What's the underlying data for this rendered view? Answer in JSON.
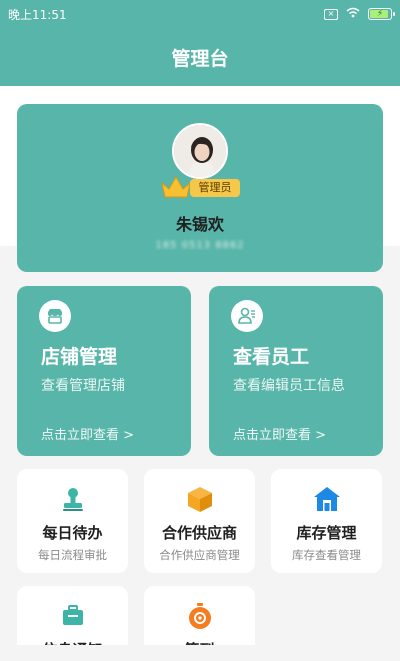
{
  "status_bar": {
    "time": "晚上11:51",
    "sim_icon": "sim-x-icon",
    "wifi_icon": "wifi-icon",
    "battery_icon": "battery-charging-icon"
  },
  "header": {
    "title": "管理台"
  },
  "profile": {
    "avatar_icon": "avatar-photo",
    "badge_icon": "crown-icon",
    "role_badge": "管理员",
    "name": "朱锡欢",
    "phone_masked": "185 0513 8862"
  },
  "feature_cards": [
    {
      "icon": "store-icon",
      "title": "店铺管理",
      "desc": "查看管理店铺",
      "link": "点击立即查看 >"
    },
    {
      "icon": "staff-icon",
      "title": "查看员工",
      "desc": "查看编辑员工信息",
      "link": "点击立即查看 >"
    }
  ],
  "menu_tiles": [
    {
      "icon": "stamp-icon",
      "title": "每日待办",
      "sub": "每日流程审批",
      "color": "#3db4a6"
    },
    {
      "icon": "box-icon",
      "title": "合作供应商",
      "sub": "合作供应商管理",
      "color": "#f5a623"
    },
    {
      "icon": "warehouse-icon",
      "title": "库存管理",
      "sub": "库存查看管理",
      "color": "#1e88e5"
    },
    {
      "icon": "briefcase-icon",
      "title": "信息通知",
      "sub": "",
      "color": "#3db4a6"
    },
    {
      "icon": "checkin-icon",
      "title": "签到",
      "sub": "",
      "color": "#f57c1f"
    }
  ],
  "colors": {
    "accent": "#58b5a9",
    "background": "#f4f4f4"
  }
}
